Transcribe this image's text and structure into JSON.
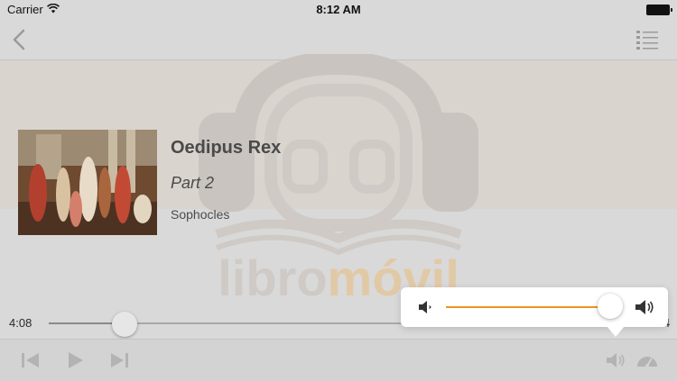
{
  "status_bar": {
    "carrier": "Carrier",
    "time": "8:12 AM"
  },
  "nav": {
    "back_icon": "chevron-left-icon",
    "playlist_icon": "list-icon"
  },
  "watermark": {
    "brand_prefix": "libro",
    "brand_suffix": "móvil"
  },
  "book": {
    "title": "Oedipus Rex",
    "part": "Part 2",
    "author": "Sophocles"
  },
  "progress": {
    "elapsed": "4:08",
    "total": "4",
    "fraction": 0.127
  },
  "controls": {
    "previous_icon": "skip-back-icon",
    "play_icon": "play-icon",
    "next_icon": "skip-forward-icon",
    "volume_icon": "speaker-icon",
    "speed_icon": "speedometer-icon"
  },
  "volume": {
    "level": 0.96
  },
  "colors": {
    "accent": "#e8961e",
    "background": "#d9d9d9",
    "band": "#d9d4ce"
  }
}
